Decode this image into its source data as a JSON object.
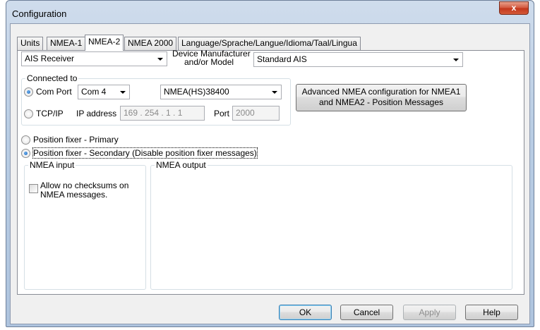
{
  "window": {
    "title": "Configuration",
    "close_label": "x"
  },
  "tabs": [
    {
      "label": "Units"
    },
    {
      "label": "NMEA-1"
    },
    {
      "label": "NMEA-2"
    },
    {
      "label": "NMEA 2000"
    },
    {
      "label": "Language/Sprache/Langue/Idioma/Taal/Lingua"
    }
  ],
  "device": {
    "type_value": "AIS Receiver",
    "manufacturer_label_line1": "Device Manufacturer",
    "manufacturer_label_line2": "and/or Model",
    "manufacturer_value": "Standard AIS"
  },
  "connected_to": {
    "title": "Connected to",
    "com_port_label": "Com Port",
    "com_port_value": "Com 4",
    "protocol_value": "NMEA(HS)38400",
    "tcpip_label": "TCP/IP",
    "ip_label": "IP address",
    "ip_value": "169 . 254 .  1  .  1",
    "port_label": "Port",
    "port_value": "2000"
  },
  "advanced_button": {
    "line1": "Advanced NMEA configuration for NMEA1",
    "line2": "and NMEA2 - Position Messages"
  },
  "position_fixer": {
    "primary_label": "Position fixer - Primary",
    "secondary_label": "Position fixer - Secondary (Disable position fixer messages)"
  },
  "nmea_input": {
    "title": "NMEA input",
    "checkbox_line1": "Allow no checksums on",
    "checkbox_line2": "NMEA messages."
  },
  "nmea_output": {
    "title": "NMEA output"
  },
  "buttons": {
    "ok": "OK",
    "cancel": "Cancel",
    "apply": "Apply",
    "help": "Help"
  }
}
